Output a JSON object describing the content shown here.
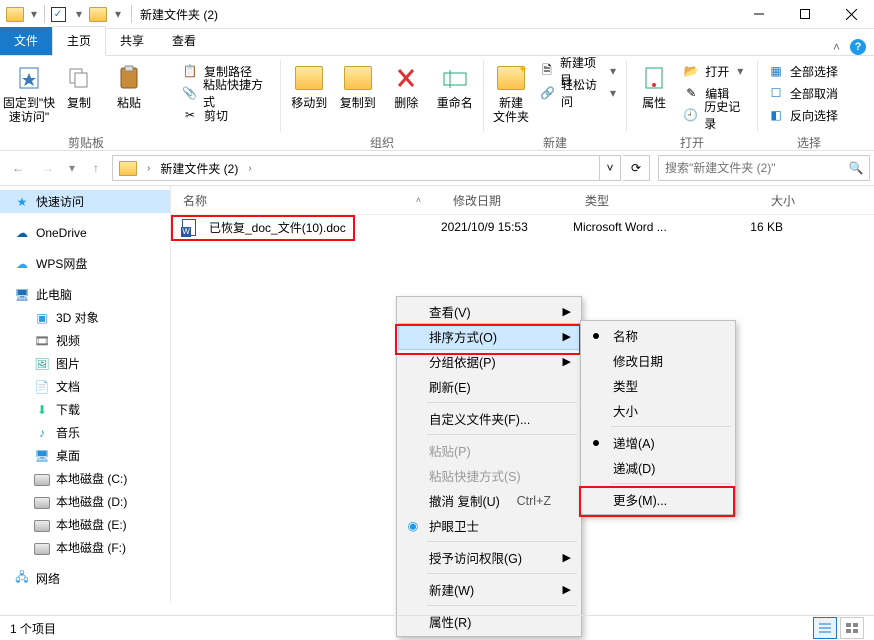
{
  "title": "新建文件夹 (2)",
  "tabs": {
    "file": "文件",
    "home": "主页",
    "share": "共享",
    "view": "查看"
  },
  "ribbon": {
    "pin": "固定到\"快\n速访问\"",
    "copy": "复制",
    "paste": "粘贴",
    "copypath": "复制路径",
    "pasteShortcut": "粘贴快捷方式",
    "cut": "剪切",
    "moveTo": "移动到",
    "copyTo": "复制到",
    "delete": "删除",
    "rename": "重命名",
    "newFolder": "新建\n文件夹",
    "newItem": "新建项目",
    "easyAccess": "轻松访问",
    "properties": "属性",
    "open": "打开",
    "edit": "编辑",
    "history": "历史记录",
    "selectAll": "全部选择",
    "selectNone": "全部取消",
    "invert": "反向选择",
    "grp_clipboard": "剪贴板",
    "grp_organize": "组织",
    "grp_new": "新建",
    "grp_open": "打开",
    "grp_select": "选择"
  },
  "breadcrumb": {
    "seg1": "新建文件夹 (2)"
  },
  "searchPlaceholder": "搜索\"新建文件夹 (2)\"",
  "columns": {
    "name": "名称",
    "date": "修改日期",
    "type": "类型",
    "size": "大小"
  },
  "file": {
    "name": "已恢复_doc_文件(10).doc",
    "date": "2021/10/9 15:53",
    "type": "Microsoft Word ...",
    "size": "16 KB"
  },
  "sidebar": {
    "quick": "快速访问",
    "onedrive": "OneDrive",
    "wps": "WPS网盘",
    "thispc": "此电脑",
    "obj3d": "3D 对象",
    "videos": "视频",
    "pictures": "图片",
    "docs": "文档",
    "downloads": "下载",
    "music": "音乐",
    "desktop": "桌面",
    "diskC": "本地磁盘 (C:)",
    "diskD": "本地磁盘 (D:)",
    "diskE": "本地磁盘 (E:)",
    "diskF": "本地磁盘 (F:)",
    "network": "网络"
  },
  "ctx": {
    "view": "查看(V)",
    "sort": "排序方式(O)",
    "group": "分组依据(P)",
    "refresh": "刷新(E)",
    "customize": "自定义文件夹(F)...",
    "paste": "粘贴(P)",
    "pasteShortcut": "粘贴快捷方式(S)",
    "undoCopy": "撤消 复制(U)",
    "undoShortcut": "Ctrl+Z",
    "eyecare": "护眼卫士",
    "grantAccess": "授予访问权限(G)",
    "new": "新建(W)",
    "properties": "属性(R)"
  },
  "sortmenu": {
    "name": "名称",
    "date": "修改日期",
    "type": "类型",
    "size": "大小",
    "asc": "递增(A)",
    "desc": "递减(D)",
    "more": "更多(M)..."
  },
  "status": "1 个项目"
}
